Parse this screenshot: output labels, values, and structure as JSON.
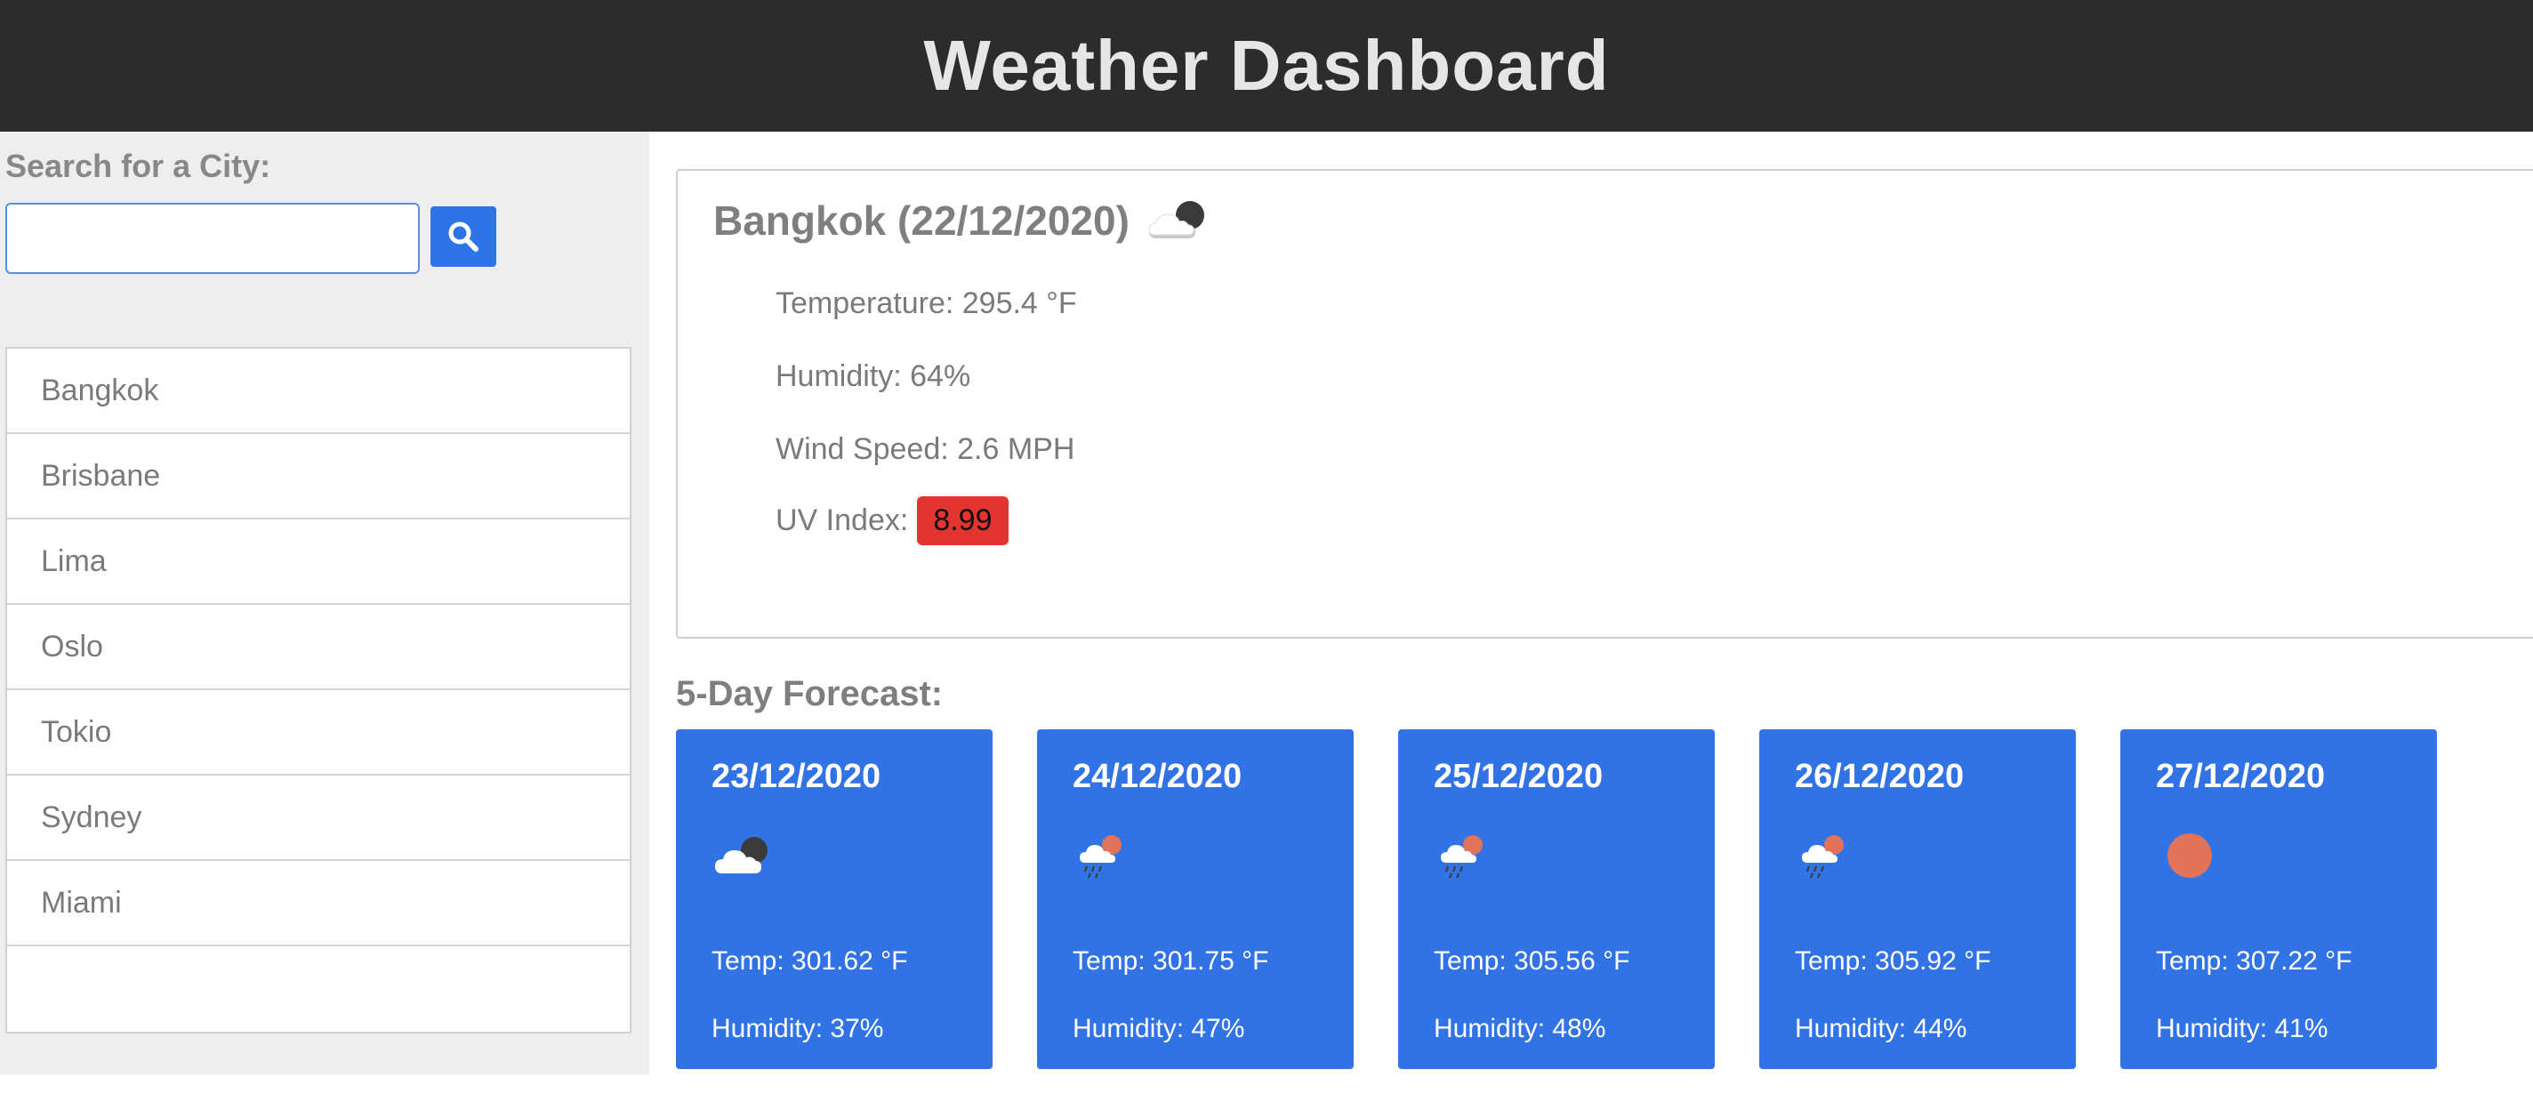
{
  "header": {
    "title": "Weather Dashboard"
  },
  "search": {
    "label": "Search for a City:",
    "input_value": "",
    "placeholder": "",
    "button_icon": "search-icon"
  },
  "cities": [
    "Bangkok",
    "Brisbane",
    "Lima",
    "Oslo",
    "Tokio",
    "Sydney",
    "Miami"
  ],
  "current": {
    "title": "Bangkok (22/12/2020)",
    "icon": "cloudy-night-icon",
    "temperature": "Temperature: 295.4 °F",
    "humidity": "Humidity: 64%",
    "wind": "Wind Speed: 2.6 MPH",
    "uv_label": "UV Index:",
    "uv_value": "8.99",
    "uv_color": "#e3342f"
  },
  "forecast": {
    "title": "5-Day Forecast:",
    "days": [
      {
        "date": "23/12/2020",
        "icon": "cloudy-night-icon",
        "temp": "Temp: 301.62 °F",
        "humidity": "Humidity: 37%"
      },
      {
        "date": "24/12/2020",
        "icon": "rain-sun-icon",
        "temp": "Temp: 301.75 °F",
        "humidity": "Humidity: 47%"
      },
      {
        "date": "25/12/2020",
        "icon": "rain-sun-icon",
        "temp": "Temp: 305.56 °F",
        "humidity": "Humidity: 48%"
      },
      {
        "date": "26/12/2020",
        "icon": "rain-sun-icon",
        "temp": "Temp: 305.92 °F",
        "humidity": "Humidity: 44%"
      },
      {
        "date": "27/12/2020",
        "icon": "clear-sun-icon",
        "temp": "Temp: 307.22 °F",
        "humidity": "Humidity: 41%"
      }
    ]
  },
  "colors": {
    "header_bg": "#2c2c2c",
    "accent_blue": "#3173e5",
    "uv_red": "#e3342f",
    "sidebar_bg": "#eeeeee"
  }
}
